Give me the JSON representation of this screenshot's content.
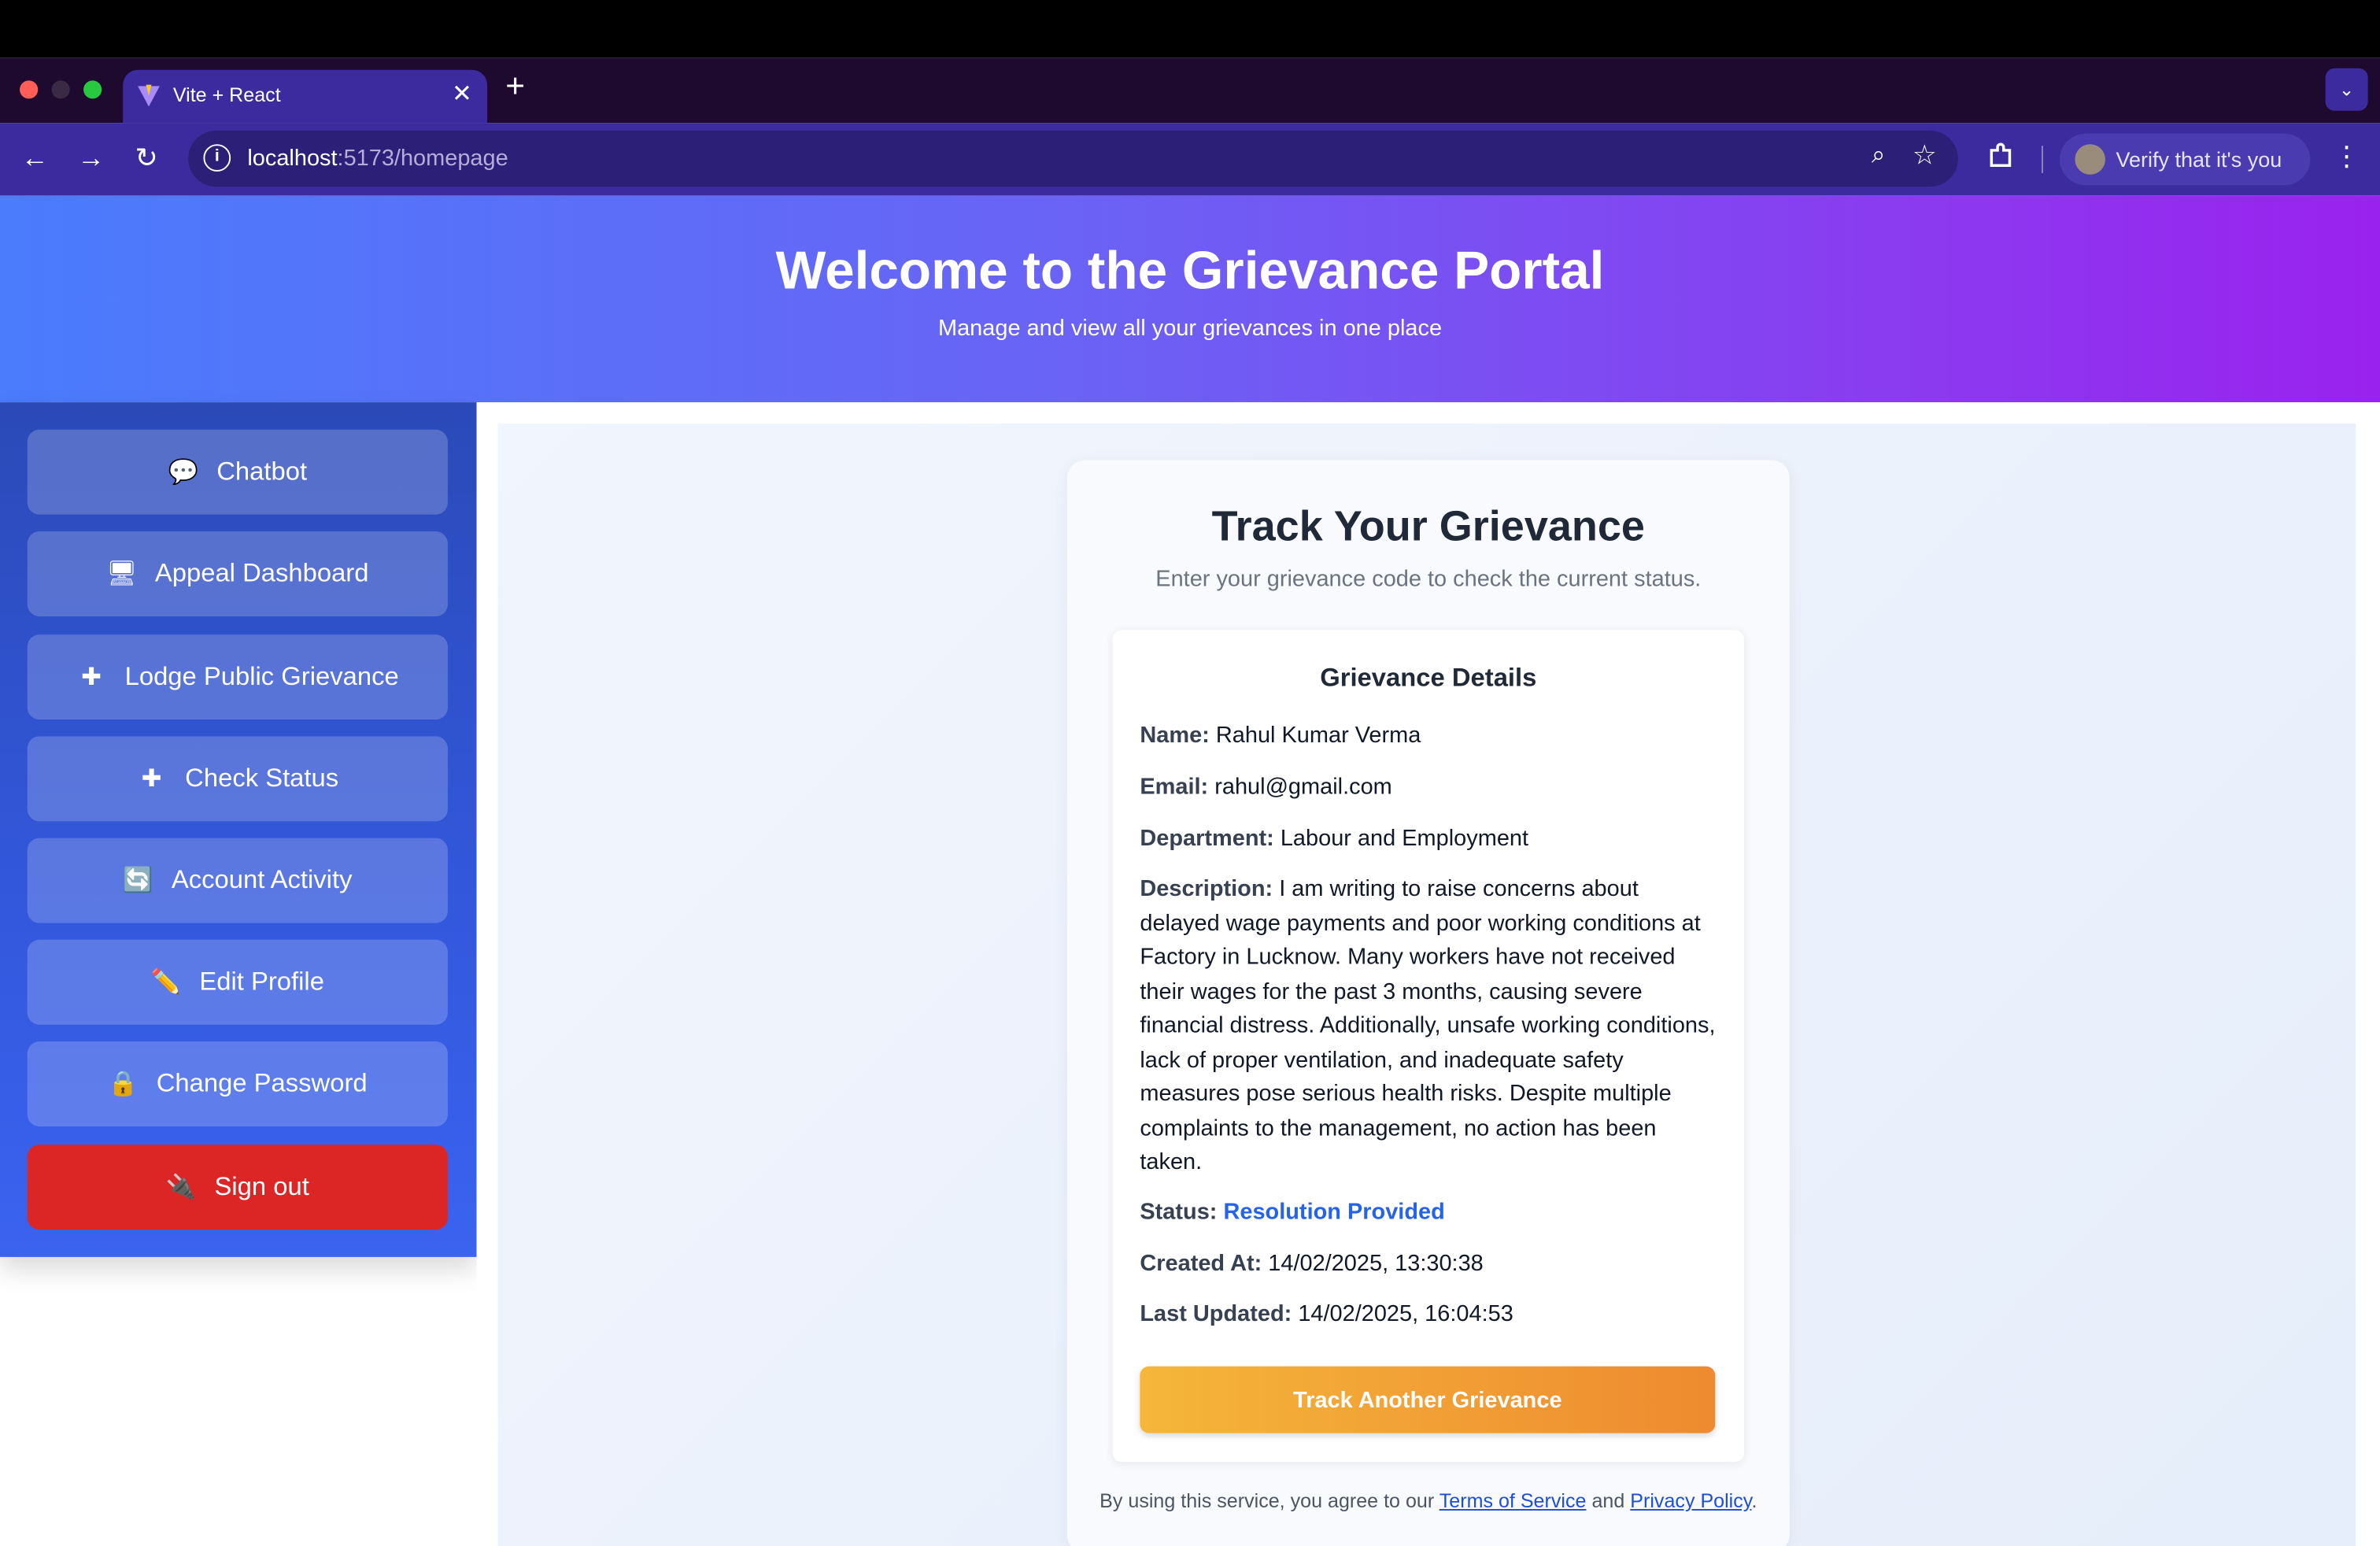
{
  "browser": {
    "tab_title": "Vite + React",
    "url_host": "localhost",
    "url_path": ":5173/homepage",
    "profile_text": "Verify that it's you"
  },
  "hero": {
    "title": "Welcome to the Grievance Portal",
    "subtitle": "Manage and view all your grievances in one place"
  },
  "sidebar": {
    "items": [
      {
        "label": "Chatbot",
        "icon": "speech-bubble-icon",
        "glyph": "💬"
      },
      {
        "label": "Appeal Dashboard",
        "icon": "monitor-icon",
        "glyph": "🖥"
      },
      {
        "label": "Lodge Public Grievance",
        "icon": "plus-icon",
        "glyph": "✚"
      },
      {
        "label": "Check Status",
        "icon": "plus-icon",
        "glyph": "✚"
      },
      {
        "label": "Account Activity",
        "icon": "refresh-icon",
        "glyph": "🔄"
      },
      {
        "label": "Edit Profile",
        "icon": "pencil-icon",
        "glyph": "✏️"
      },
      {
        "label": "Change Password",
        "icon": "lock-icon",
        "glyph": "🔒"
      },
      {
        "label": "Sign out",
        "icon": "plug-icon",
        "glyph": "🔌"
      }
    ]
  },
  "track": {
    "title": "Track Your Grievance",
    "subtitle": "Enter your grievance code to check the current status.",
    "details_title": "Grievance Details",
    "fields": {
      "name_label": "Name:",
      "name": "Rahul Kumar Verma",
      "email_label": "Email:",
      "email": "rahul@gmail.com",
      "department_label": "Department:",
      "department": "Labour and Employment",
      "description_label": "Description:",
      "description": "I am writing to raise concerns about delayed wage payments and poor working conditions at Factory in Lucknow. Many workers have not received their wages for the past 3 months, causing severe financial distress. Additionally, unsafe working conditions, lack of proper ventilation, and inadequate safety measures pose serious health risks. Despite multiple complaints to the management, no action has been taken.",
      "status_label": "Status:",
      "status": "Resolution Provided",
      "created_label": "Created At:",
      "created": "14/02/2025, 13:30:38",
      "updated_label": "Last Updated:",
      "updated": "14/02/2025, 16:04:53"
    },
    "button": "Track Another Grievance",
    "footer": {
      "prefix": "By using this service, you agree to our",
      "terms": "Terms of Service",
      "and": "and",
      "privacy": "Privacy Policy",
      "suffix": "."
    }
  },
  "colors": {
    "accent_blue": "#2563eb",
    "signout_red": "#dc2626",
    "track_button_start": "#f5b63a",
    "track_button_end": "#ee8a30"
  }
}
